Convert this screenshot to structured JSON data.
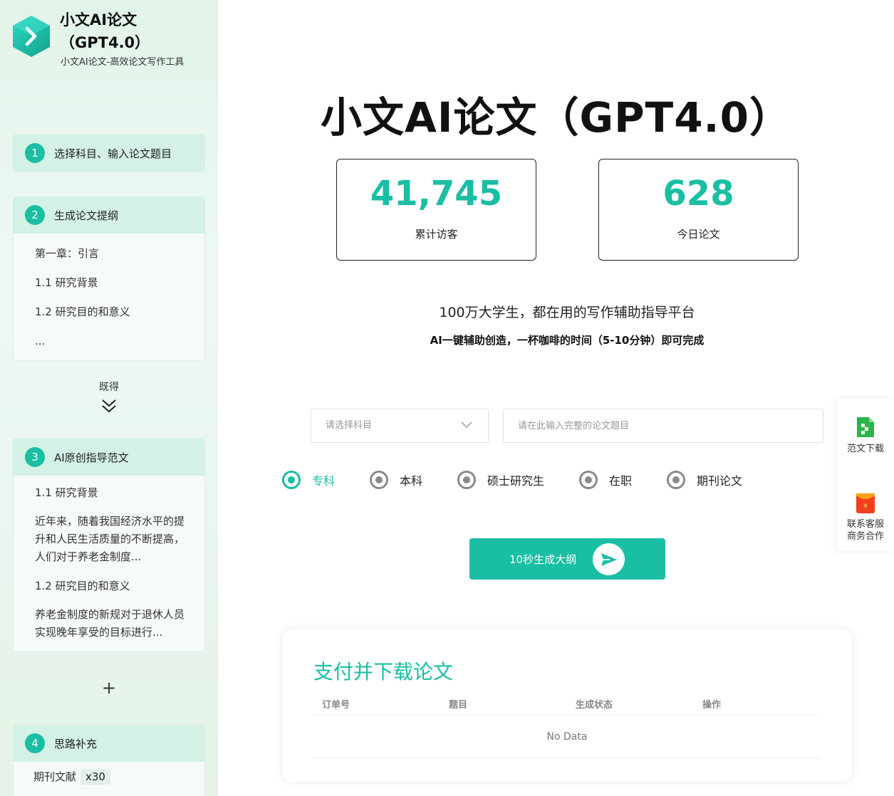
{
  "brand": {
    "title": "小文AI论文（GPT4.0）",
    "subtitle": "小文AI论文-高效论文写作工具"
  },
  "steps": {
    "step1": {
      "num": "1",
      "label": "选择科目、输入论文题目"
    },
    "step2": {
      "num": "2",
      "label": "生成论文提纲",
      "items": [
        "第一章：引言",
        "1.1 研究背景",
        "1.2 研究目的和意义",
        "..."
      ]
    },
    "between_label": "既得",
    "step3": {
      "num": "3",
      "label": "AI原创指导范文",
      "items": [
        "1.1 研究背景",
        "近年来，随着我国经济水平的提升和人民生活质量的不断提高，人们对于养老金制度...",
        "1.2 研究目的和意义",
        "养老金制度的新规对于退休人员实现晚年享受的目标进行..."
      ]
    },
    "plus": "+",
    "step4": {
      "num": "4",
      "label": "思路补充",
      "item_label": "期刊文献",
      "item_count": "x30"
    }
  },
  "main": {
    "title": "小文AI论文（GPT4.0）",
    "stats": [
      {
        "value": "41,745",
        "label": "累计访客"
      },
      {
        "value": "628",
        "label": "今日论文"
      }
    ],
    "tagline": "100万大学生，都在用的写作辅助指导平台",
    "tagline2": "AI一键辅助创造，一杯咖啡的时间（5-10分钟）即可完成",
    "subject_placeholder": "请选择科目",
    "title_placeholder": "请在此输入完整的论文题目",
    "levels": [
      "专科",
      "本科",
      "硕士研究生",
      "在职",
      "期刊论文"
    ],
    "selected_level": "专科",
    "generate_label": "10秒生成大纲"
  },
  "pay": {
    "title": "支付并下载论文",
    "columns": [
      "订单号",
      "题目",
      "生成状态",
      "操作"
    ],
    "empty_text": "No Data"
  },
  "float": {
    "download_label": "范文下载",
    "service_line1": "联系客服",
    "service_line2": "商务合作"
  },
  "colors": {
    "accent": "#19bea3",
    "sidebar_head": "#d3f1e4"
  }
}
